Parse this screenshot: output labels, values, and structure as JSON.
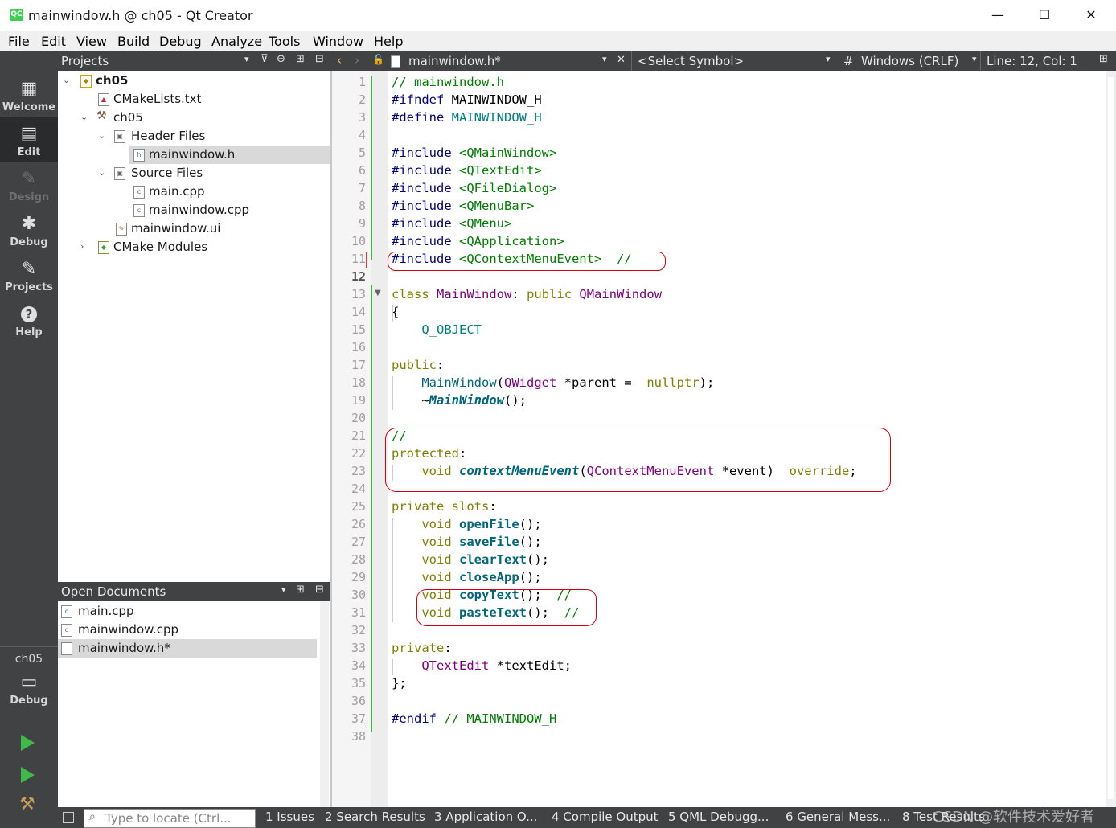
{
  "window": {
    "app_icon": "QC",
    "title": "mainwindow.h @ ch05 - Qt Creator",
    "minimize": "—",
    "maximize": "☐",
    "close": "✕"
  },
  "menubar": [
    "File",
    "Edit",
    "View",
    "Build",
    "Debug",
    "Analyze",
    "Tools",
    "Window",
    "Help"
  ],
  "modes": [
    {
      "label": "Welcome",
      "icon": "grid-icon",
      "glyph": "▦"
    },
    {
      "label": "Edit",
      "icon": "edit-icon",
      "glyph": "▤"
    },
    {
      "label": "Design",
      "icon": "pencil-icon",
      "glyph": "✎"
    },
    {
      "label": "Debug",
      "icon": "bug-icon",
      "glyph": "✱"
    },
    {
      "label": "Projects",
      "icon": "wrench-icon",
      "glyph": "🔧"
    },
    {
      "label": "Help",
      "icon": "help-icon",
      "glyph": "?"
    }
  ],
  "kit": {
    "project": "ch05",
    "config": "Debug"
  },
  "projects_panel": {
    "title": "Projects",
    "tree": [
      {
        "label": "ch05",
        "bold": true
      },
      {
        "label": "CMakeLists.txt"
      },
      {
        "label": "ch05"
      },
      {
        "label": "Header Files"
      },
      {
        "label": "mainwindow.h",
        "selected": true
      },
      {
        "label": "Source Files"
      },
      {
        "label": "main.cpp"
      },
      {
        "label": "mainwindow.cpp"
      },
      {
        "label": "mainwindow.ui"
      },
      {
        "label": "CMake Modules"
      }
    ]
  },
  "open_documents": {
    "title": "Open Documents",
    "items": [
      {
        "label": "main.cpp"
      },
      {
        "label": "mainwindow.cpp"
      },
      {
        "label": "mainwindow.h*",
        "selected": true
      }
    ]
  },
  "editor_toolbar": {
    "file": "mainwindow.h*",
    "symbol": "<Select Symbol>",
    "hash": "#",
    "line_ending": "Windows (CRLF)",
    "position": "Line: 12, Col: 1"
  },
  "editor": {
    "current_line": 12,
    "line_numbers": [
      "1",
      "2",
      "3",
      "4",
      "5",
      "6",
      "7",
      "8",
      "9",
      "10",
      "11",
      "12",
      "13",
      "14",
      "15",
      "16",
      "17",
      "18",
      "19",
      "20",
      "21",
      "22",
      "23",
      "24",
      "25",
      "26",
      "27",
      "28",
      "29",
      "30",
      "31",
      "32",
      "33",
      "34",
      "35",
      "36",
      "37",
      "38"
    ],
    "lines": [
      [
        [
          "cm",
          "// mainwindow.h"
        ]
      ],
      [
        [
          "pp",
          "#ifndef"
        ],
        [
          "",
          "MAINWINDOW_H"
        ]
      ],
      [
        [
          "pp",
          "#define"
        ],
        [
          "mac",
          "MAINWINDOW_H"
        ]
      ],
      [],
      [
        [
          "pp",
          "#include"
        ],
        [
          "inc",
          "<QMainWindow>"
        ]
      ],
      [
        [
          "pp",
          "#include"
        ],
        [
          "inc",
          "<QTextEdit>"
        ]
      ],
      [
        [
          "pp",
          "#include"
        ],
        [
          "inc",
          "<QFileDialog>"
        ]
      ],
      [
        [
          "pp",
          "#include"
        ],
        [
          "inc",
          "<QMenuBar>"
        ]
      ],
      [
        [
          "pp",
          "#include"
        ],
        [
          "inc",
          "<QMenu>"
        ]
      ],
      [
        [
          "pp",
          "#include"
        ],
        [
          "inc",
          "<QApplication>"
        ]
      ],
      [
        [
          "pp",
          "#include"
        ],
        [
          "inc",
          "<QContextMenuEvent>  //"
        ]
      ],
      [],
      [
        [
          "kw",
          "class"
        ],
        [
          "ty",
          "MainWindow"
        ],
        [
          "",
          ":"
        ],
        [
          "kw",
          "public"
        ],
        [
          "ty",
          "QMainWindow"
        ]
      ],
      [
        [
          "",
          "{"
        ]
      ],
      [
        [
          "mac",
          "    Q_OBJECT"
        ]
      ],
      [],
      [
        [
          "kw",
          "public"
        ],
        [
          "",
          ":"
        ]
      ],
      [
        [
          "fnc",
          "    MainWindow"
        ],
        [
          "",
          "("
        ],
        [
          "ty",
          "QWidget"
        ],
        [
          "",
          " *parent = "
        ],
        [
          "kw",
          "nullptr"
        ],
        [
          "",
          ");"
        ]
      ],
      [
        [
          "",
          "    ~"
        ],
        [
          "fni",
          "MainWindow"
        ],
        [
          "",
          "();"
        ]
      ],
      [],
      [
        [
          "cm",
          "//"
        ]
      ],
      [
        [
          "kw",
          "protected"
        ],
        [
          "",
          ":"
        ]
      ],
      [
        [
          "kw",
          "    void"
        ],
        [
          "fni",
          "contextMenuEvent"
        ],
        [
          "",
          "("
        ],
        [
          "ty",
          "QContextMenuEvent"
        ],
        [
          "",
          " *event) "
        ],
        [
          "kw",
          "override"
        ],
        [
          "",
          ";"
        ]
      ],
      [],
      [
        [
          "kw",
          "private slots"
        ],
        [
          "",
          ":"
        ]
      ],
      [
        [
          "kw",
          "    void"
        ],
        [
          "fn",
          "openFile"
        ],
        [
          "",
          "();"
        ]
      ],
      [
        [
          "kw",
          "    void"
        ],
        [
          "fn",
          "saveFile"
        ],
        [
          "",
          "();"
        ]
      ],
      [
        [
          "kw",
          "    void"
        ],
        [
          "fn",
          "clearText"
        ],
        [
          "",
          "();"
        ]
      ],
      [
        [
          "kw",
          "    void"
        ],
        [
          "fn",
          "closeApp"
        ],
        [
          "",
          "();"
        ]
      ],
      [
        [
          "kw",
          "    void"
        ],
        [
          "fn",
          "copyText"
        ],
        [
          "",
          "(); "
        ],
        [
          "cm",
          "//"
        ]
      ],
      [
        [
          "kw",
          "    void"
        ],
        [
          "fn",
          "pasteText"
        ],
        [
          "",
          "(); "
        ],
        [
          "cm",
          "//"
        ]
      ],
      [],
      [
        [
          "kw",
          "private"
        ],
        [
          "",
          ":"
        ]
      ],
      [
        [
          "ty",
          "    QTextEdit"
        ],
        [
          "",
          " *textEdit;"
        ]
      ],
      [
        [
          "",
          "};"
        ]
      ],
      [],
      [
        [
          "pp",
          "#endif"
        ],
        [
          "cm",
          "// MAINWINDOW_H"
        ]
      ],
      []
    ]
  },
  "locator": {
    "placeholder": "Type to locate (Ctrl..."
  },
  "output_panes": [
    "1  Issues",
    "2  Search Results",
    "3  Application O...",
    "4  Compile Output",
    "5  QML Debugg...",
    "6  General Mess...",
    "8  Test Results"
  ],
  "watermark": "CSDN @软件技术爱好者"
}
